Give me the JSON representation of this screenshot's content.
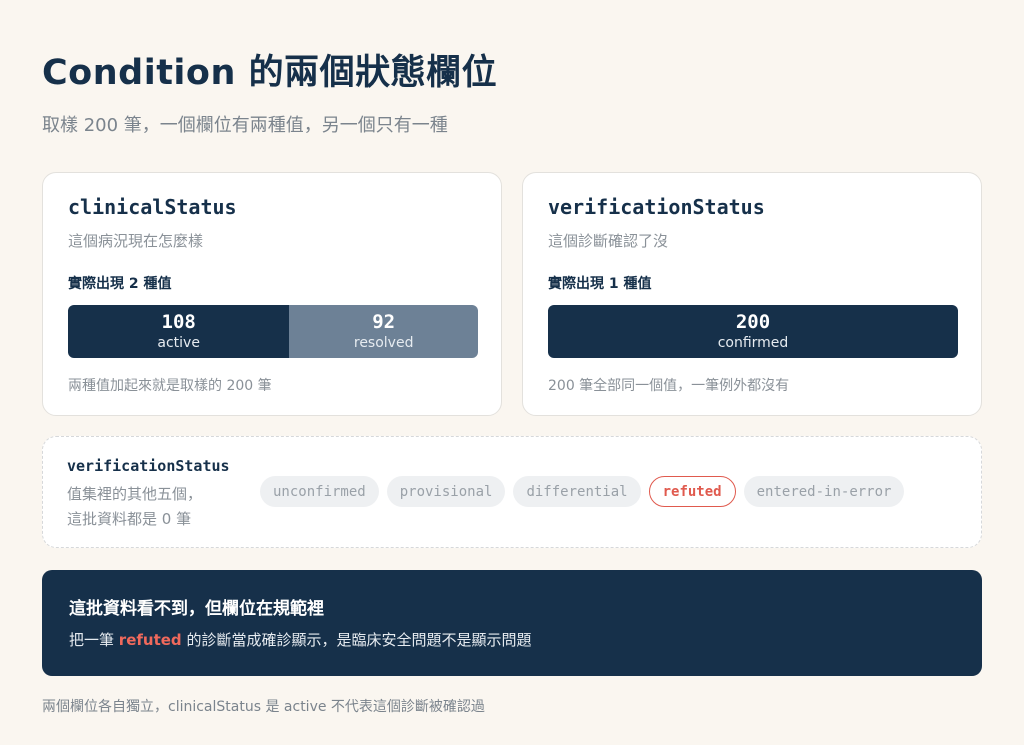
{
  "title": "Condition 的兩個狀態欄位",
  "subtitle": "取樣 200 筆，一個欄位有兩種值，另一個只有一種",
  "clinical": {
    "field": "clinicalStatus",
    "desc": "這個病況現在怎麼樣",
    "count_label": "實際出現 2 種值",
    "segments": [
      {
        "value": "108",
        "label": "active",
        "fraction": 0.54
      },
      {
        "value": "92",
        "label": "resolved",
        "fraction": 0.46
      }
    ],
    "note": "兩種值加起來就是取樣的 200 筆"
  },
  "verification": {
    "field": "verificationStatus",
    "desc": "這個診斷確認了沒",
    "count_label": "實際出現 1 種值",
    "segments": [
      {
        "value": "200",
        "label": "confirmed",
        "fraction": 1.0
      }
    ],
    "note": "200 筆全部同一個值，一筆例外都沒有"
  },
  "other_values": {
    "field": "verificationStatus",
    "desc_line1": "值集裡的其他五個，",
    "desc_line2": "這批資料都是 0 筆",
    "chips": [
      "unconfirmed",
      "provisional",
      "differential",
      "refuted",
      "entered-in-error"
    ],
    "highlighted": "refuted"
  },
  "callout": {
    "heading": "這批資料看不到，但欄位在規範裡",
    "body_before": "把一筆",
    "body_accent": "refuted",
    "body_after": "的診斷當成確診顯示，是臨床安全問題不是顯示問題"
  },
  "footer": "兩個欄位各自獨立，clinicalStatus 是 active 不代表這個診斷被確認過",
  "colors": {
    "background": "#faf6f0",
    "navy": "#16304a",
    "slate": "#6d8196",
    "accent_red": "#e05a4e"
  }
}
